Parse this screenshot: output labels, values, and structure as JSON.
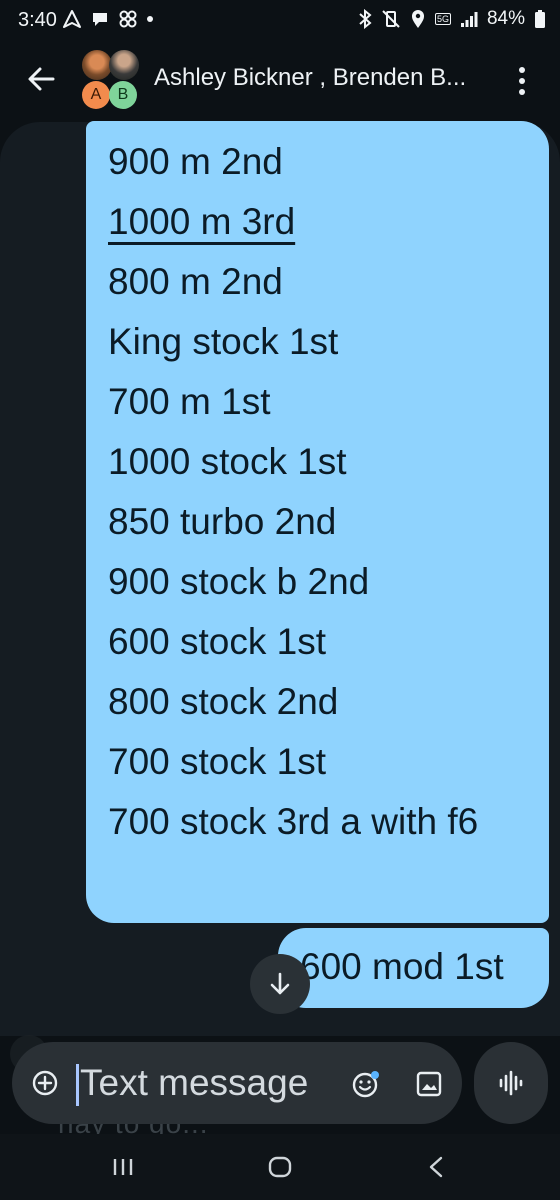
{
  "status_bar": {
    "time": "3:40",
    "network": "5G",
    "battery": "84%",
    "left_icons": [
      "navigation-icon",
      "chat-bubble-icon",
      "pinwheel-icon",
      "dot-icon"
    ],
    "right_icons": [
      "bluetooth-icon",
      "vibrate-mute-icon",
      "location-icon",
      "signal-icon",
      "battery-icon"
    ]
  },
  "header": {
    "title": "Ashley Bickner , Brenden B...",
    "avatar_a": "A",
    "avatar_b": "B"
  },
  "messages": {
    "main_lines": [
      "900 m 2nd",
      "1000 m 3rd",
      "800 m 2nd",
      "King stock 1st",
      "700 m 1st",
      "1000 stock 1st",
      "850 turbo 2nd",
      "900 stock b 2nd",
      "600 stock 1st",
      "800 stock 2nd",
      "700 stock 1st",
      "700 stock 3rd a with f6"
    ],
    "second": "600 mod 1st",
    "behind_compose": "hay to go..."
  },
  "compose": {
    "placeholder": "Text message"
  },
  "colors": {
    "bubble": "#8fd3fe",
    "background": "#0c1115",
    "panel": "#151c22",
    "compose": "#2a3035"
  }
}
